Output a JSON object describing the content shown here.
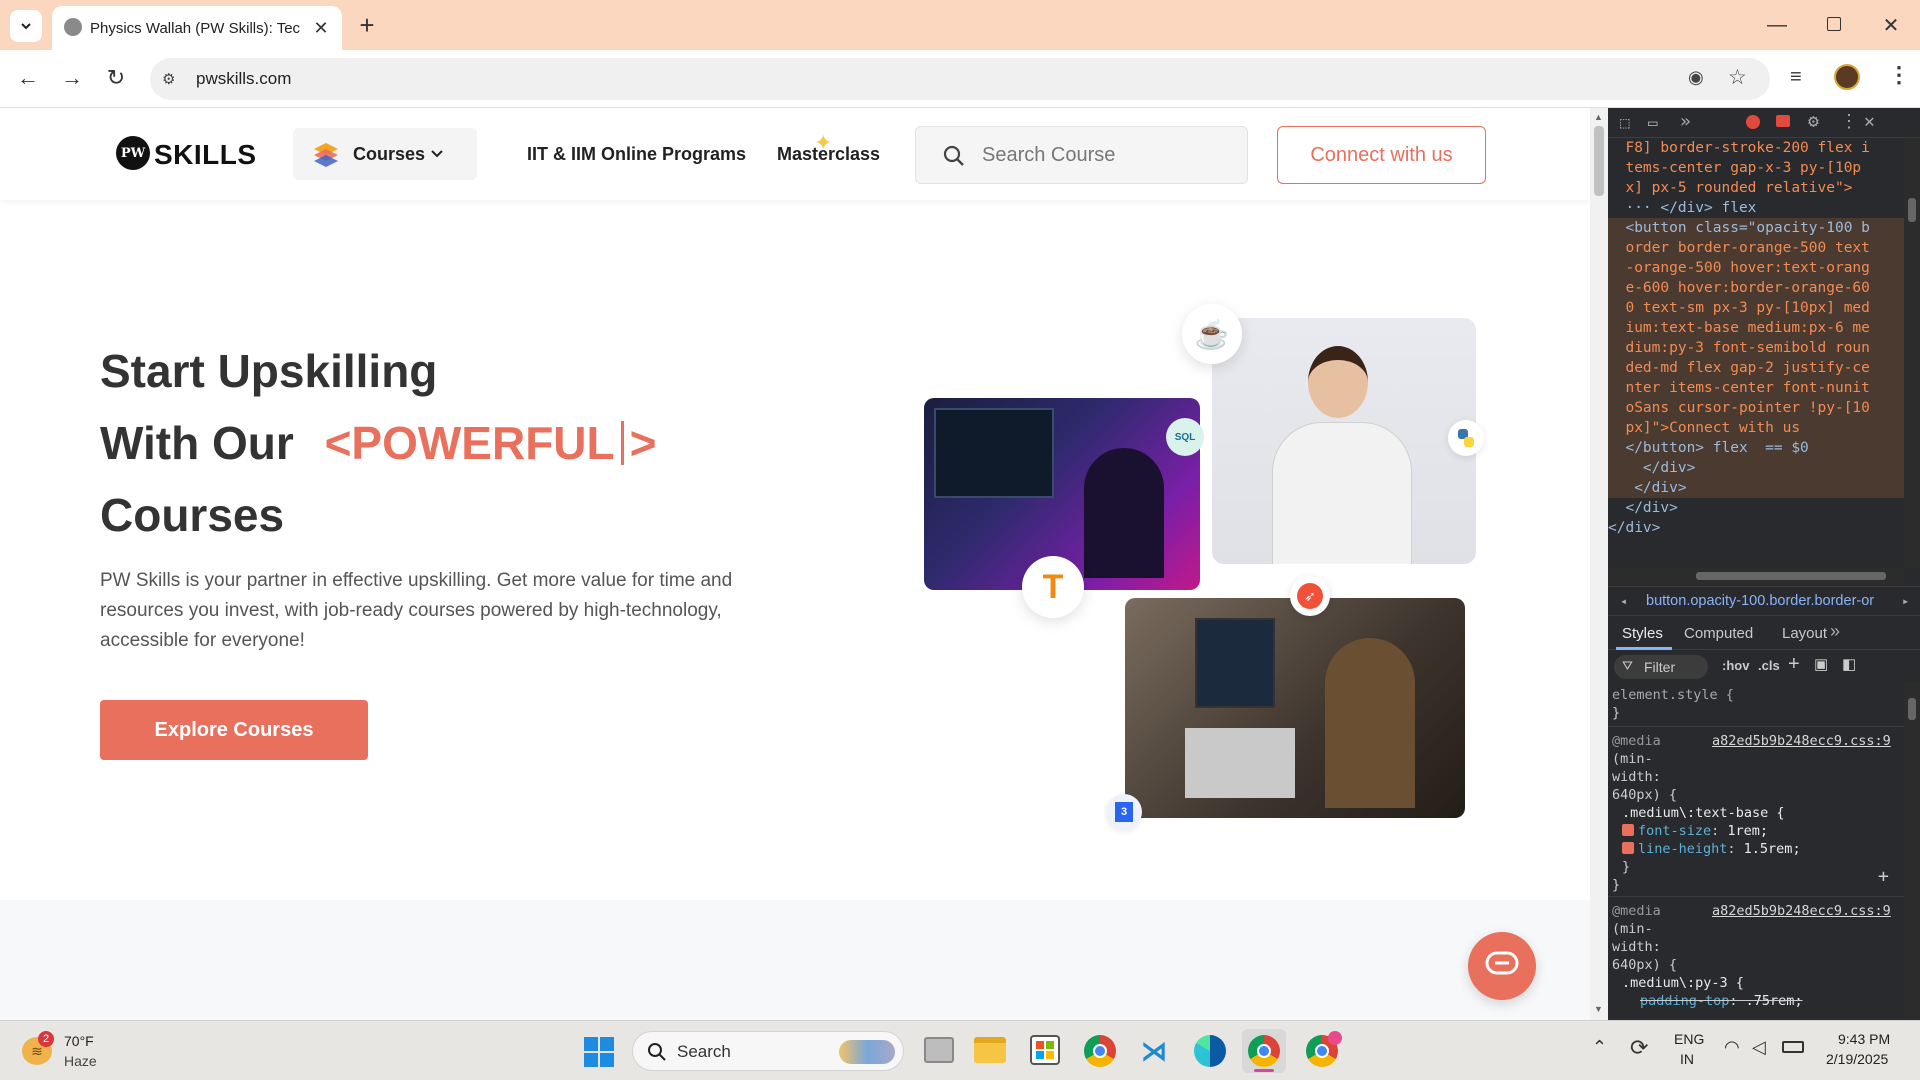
{
  "browser": {
    "tab_title": "Physics Wallah (PW Skills): Tech",
    "url": "pwskills.com"
  },
  "nav": {
    "logo_text": "SKILLS",
    "courses_label": "Courses",
    "iit_label": "IIT & IIM Online Programs",
    "masterclass_label": "Masterclass",
    "search_placeholder": "Search Course",
    "connect_label": "Connect with us"
  },
  "hero": {
    "line1": "Start Upskilling",
    "line2_prefix": "With Our",
    "line2_highlight": "<POWERFUL",
    "line2_close": ">",
    "line3": "Courses",
    "description": "PW Skills is your partner in effective upskilling. Get more value for time and resources you invest, with job-ready courses powered by high-technology, accessible for everyone!",
    "cta_label": "Explore Courses"
  },
  "devtools": {
    "code_lines": [
      "  F8] border-stroke-200 flex i",
      "  tems-center gap-x-3 py-[10p",
      "  x] px-5 rounded relative\">",
      "  ··· </div> flex",
      "  <button class=\"opacity-100 b",
      "  order border-orange-500 text",
      "  -orange-500 hover:text-orang",
      "  e-600 hover:border-orange-60",
      "  0 text-sm px-3 py-[10px] med",
      "  ium:text-base medium:px-6 me",
      "  dium:py-3 font-semibold roun",
      "  ded-md flex gap-2 justify-ce",
      "  nter items-center font-nunit",
      "  oSans cursor-pointer !py-[10",
      "  px]\">Connect with us",
      "  </button> flex  == $0",
      "    </div>",
      "   </div>",
      "  </div>",
      "</div>"
    ],
    "breadcrumb": "button.opacity-100.border.border-or",
    "tabs": [
      "Styles",
      "Computed",
      "Layout"
    ],
    "filter_placeholder": "Filter",
    "hov": ":hov",
    "cls": ".cls",
    "element_style": "element.style {",
    "close_brace": "}",
    "rule1_media": "@media",
    "rule1_src": "a82ed5b9b248ecc9.css:9",
    "rule1_cond1": "(min-",
    "rule1_cond2": "width:",
    "rule1_cond3": "640px) {",
    "rule1_selector": ".medium\\:text-base {",
    "rule1_prop1_name": "font-size",
    "rule1_prop1_val": "1rem;",
    "rule1_prop2_name": "line-height",
    "rule1_prop2_val": "1.5rem;",
    "rule2_media": "@media",
    "rule2_src": "a82ed5b9b248ecc9.css:9",
    "rule2_selector": ".medium\\:py-3 {",
    "rule2_prop1_name": "padding-top",
    "rule2_prop1_val": ".75rem;"
  },
  "taskbar": {
    "weather_temp": "70°F",
    "weather_desc": "Haze",
    "weather_badge": "2",
    "search_label": "Search",
    "lang1": "ENG",
    "lang2": "IN",
    "time": "9:43 PM",
    "date": "2/19/2025"
  },
  "colors": {
    "accent": "#e8705c",
    "tabstrip": "#fcd7c0",
    "devtools_bg": "#292a2d",
    "devtools_selected": "#4b3a2f"
  }
}
